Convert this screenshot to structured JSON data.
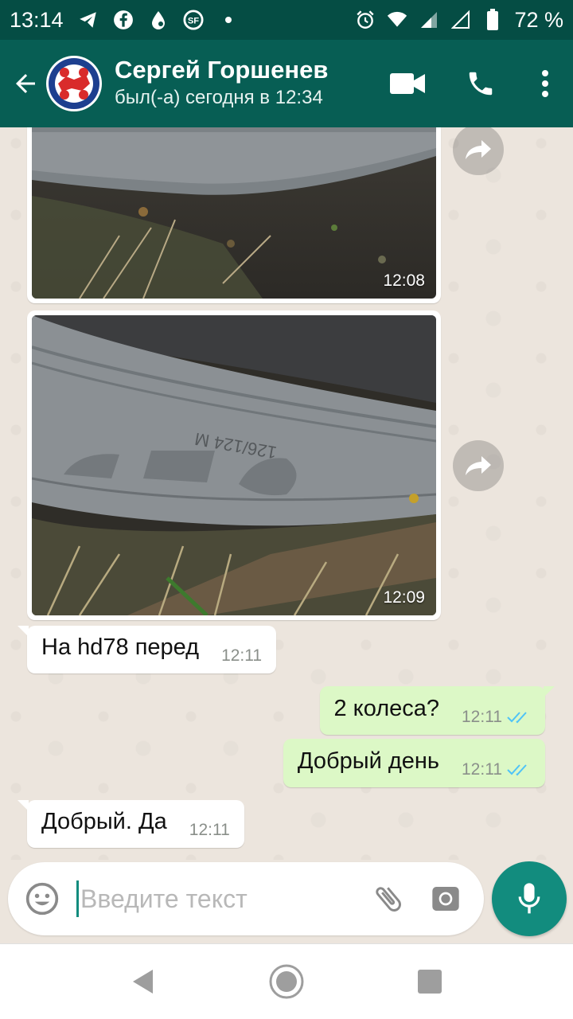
{
  "status_bar": {
    "time": "13:14",
    "battery_percent": "72 %",
    "icons": [
      "telegram-icon",
      "facebook-icon",
      "droplet-icon",
      "sf-app-icon",
      "dot-icon",
      "alarm-icon",
      "wifi-icon",
      "signal-icon",
      "signal-empty-icon",
      "battery-icon"
    ]
  },
  "header": {
    "contact_name": "Сергей Горшенев",
    "last_seen": "был(-а) сегодня в 12:34",
    "icons": [
      "back-arrow-icon",
      "video-call-icon",
      "phone-icon",
      "more-vert-icon"
    ]
  },
  "messages": [
    {
      "type": "image",
      "direction": "in",
      "time": "12:08",
      "forward_icon": "forward-icon"
    },
    {
      "type": "image",
      "direction": "in",
      "time": "12:09",
      "forward_icon": "forward-icon"
    },
    {
      "type": "text",
      "direction": "in",
      "text": "На hd78 перед",
      "time": "12:11"
    },
    {
      "type": "text",
      "direction": "out",
      "text": "2 колеса?",
      "time": "12:11",
      "status": "read"
    },
    {
      "type": "text",
      "direction": "out",
      "text": "Добрый день",
      "time": "12:11",
      "status": "read"
    },
    {
      "type": "text",
      "direction": "in",
      "text": "Добрый. Да",
      "time": "12:11"
    }
  ],
  "composer": {
    "placeholder": "Введите текст",
    "value": "",
    "icons": [
      "emoji-icon",
      "attach-icon",
      "camera-icon",
      "mic-icon"
    ]
  },
  "colors": {
    "status_bar": "#054d44",
    "app_bar": "#075e54",
    "chat_bg": "#ece5dd",
    "bubble_in": "#ffffff",
    "bubble_out": "#dcf8c6",
    "accent": "#128c7e",
    "read_ticks": "#4fc3f7"
  }
}
